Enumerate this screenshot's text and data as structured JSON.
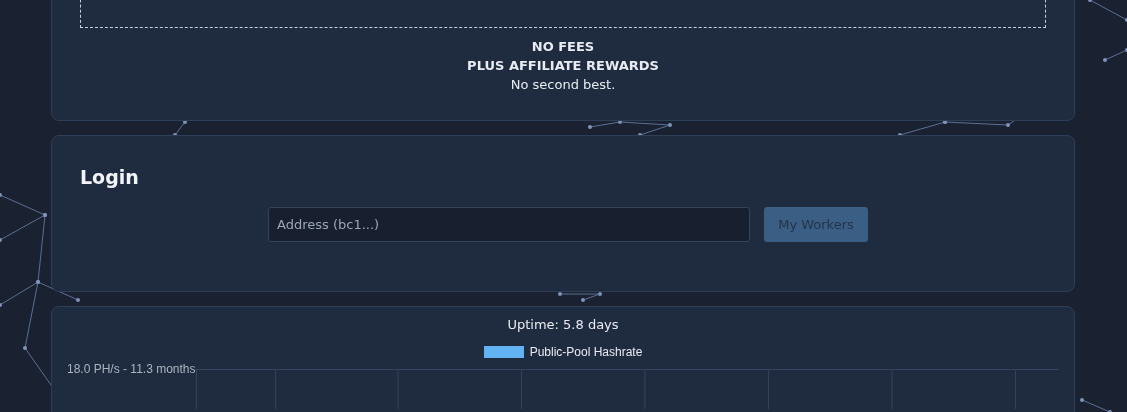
{
  "hero": {
    "lines": [
      "NO FEES",
      "PLUS AFFILIATE REWARDS"
    ],
    "tagline": "No second best."
  },
  "login": {
    "title": "Login",
    "address_field": {
      "placeholder": "Address (bc1...)"
    },
    "button": {
      "label": "My Workers",
      "disabled": true
    }
  },
  "stats": {
    "uptime": "Uptime: 5.8 days",
    "legend": [
      {
        "label": "Public-Pool Hashrate",
        "color": "#63b3f4"
      }
    ],
    "y_tick_label": "18.0 PH/s - 11.3 months"
  }
}
